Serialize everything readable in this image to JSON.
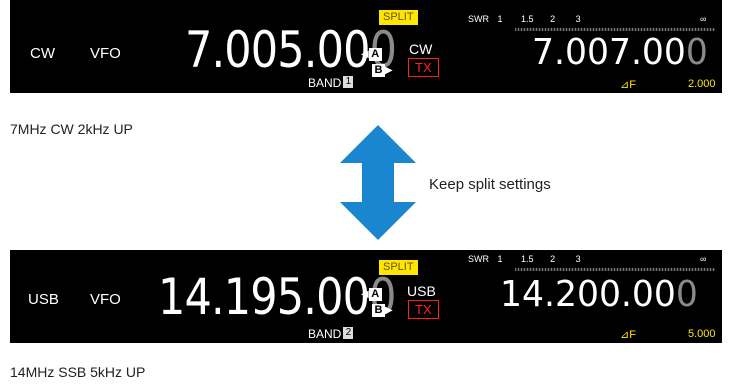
{
  "panels": [
    {
      "split_label": "SPLIT",
      "swr": {
        "label": "SWR",
        "ticks": [
          "1",
          "1.5",
          "2",
          "3",
          "∞"
        ]
      },
      "mode": "CW",
      "vfo": "VFO",
      "main_frequency": {
        "bright": "7.005.00",
        "dim": "0"
      },
      "vfo_a": "A",
      "vfo_b": "B",
      "band_label": "BAND",
      "band_number": "1",
      "sub_mode": "CW",
      "tx": "TX",
      "sub_frequency": {
        "bright": "7.007.00",
        "dim": "0"
      },
      "delta_f": "⊿F",
      "offset": "2.000"
    },
    {
      "split_label": "SPLIT",
      "swr": {
        "label": "SWR",
        "ticks": [
          "1",
          "1.5",
          "2",
          "3",
          "∞"
        ]
      },
      "mode": "USB",
      "vfo": "VFO",
      "main_frequency": {
        "bright": "14.195.00",
        "dim": "0"
      },
      "vfo_a": "A",
      "vfo_b": "B",
      "band_label": "BAND",
      "band_number": "2",
      "sub_mode": "USB",
      "tx": "TX",
      "sub_frequency": {
        "bright": "14.200.00",
        "dim": "0"
      },
      "delta_f": "⊿F",
      "offset": "5.000"
    }
  ],
  "captions": {
    "top": "7MHz CW 2kHz UP",
    "bottom": "14MHz SSB 5kHz UP"
  },
  "keep_label": "Keep split settings",
  "colors": {
    "arrow": "#1a86d0",
    "split_bg": "#ffe600",
    "tx": "#ff2020",
    "panel_bg": "#000000"
  }
}
